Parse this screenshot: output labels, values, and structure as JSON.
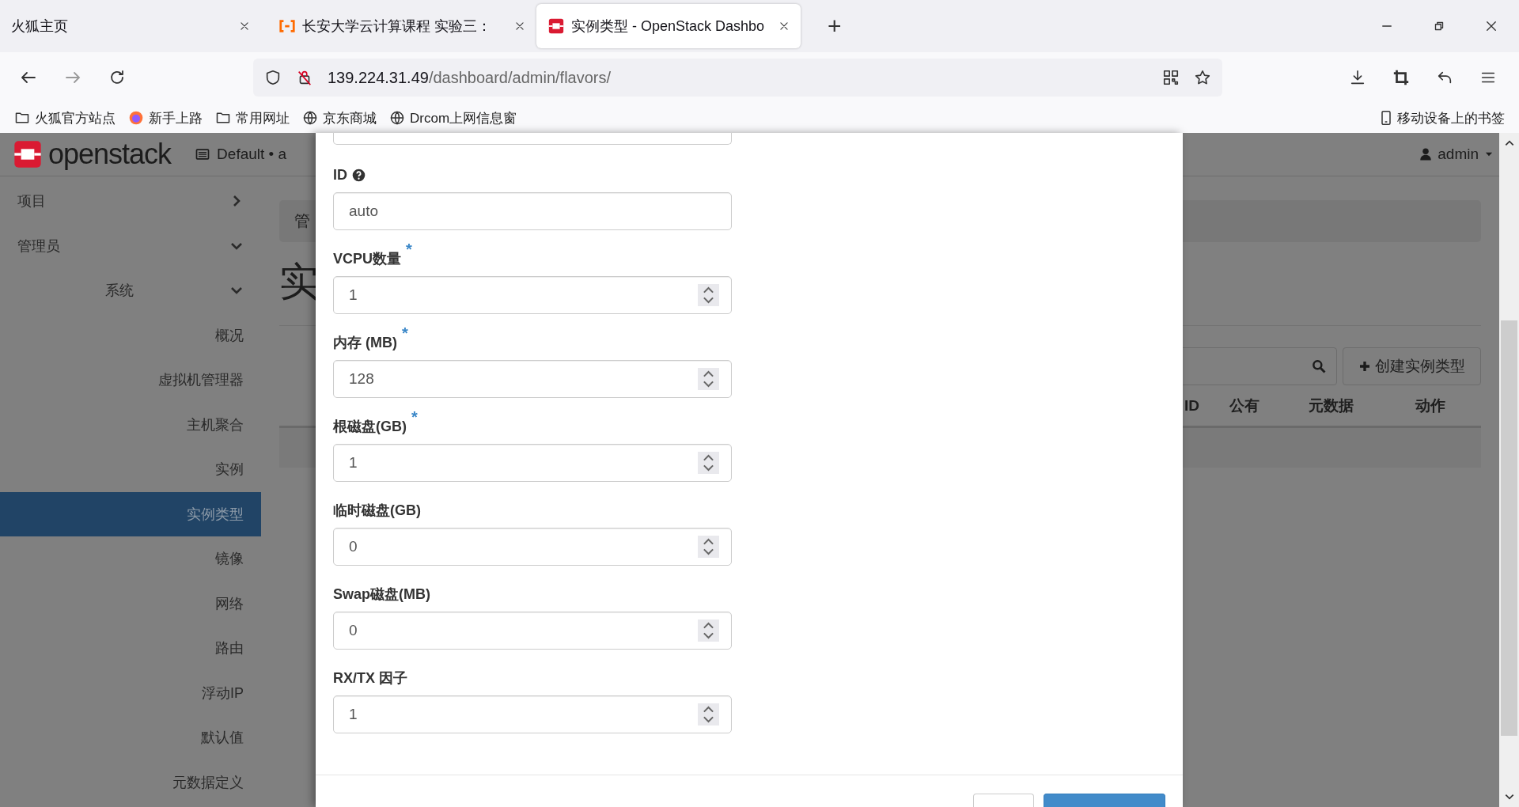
{
  "browser": {
    "tabs": [
      {
        "title": "火狐主页",
        "kind": "plain",
        "selected": false
      },
      {
        "title": "长安大学云计算课程 实验三：",
        "kind": "bracket",
        "selected": false
      },
      {
        "title": "实例类型 - OpenStack Dashbo",
        "kind": "stack",
        "selected": true
      }
    ],
    "new_tab": "+",
    "url": {
      "host": "139.224.31.49",
      "path": "/dashboard/admin/flavors/"
    },
    "bookmarks": [
      {
        "label": "火狐官方站点",
        "kind": "folder"
      },
      {
        "label": "新手上路",
        "kind": "browser"
      },
      {
        "label": "常用网址",
        "kind": "folder"
      },
      {
        "label": "京东商城",
        "kind": "site"
      },
      {
        "label": "Drcom上网信息窗",
        "kind": "site"
      }
    ],
    "mobile_bookmarks": "移动设备上的书签"
  },
  "header": {
    "logo": "openstack",
    "project": "Default • a",
    "user": "admin"
  },
  "sidebar": {
    "items": [
      {
        "label": "项目",
        "expanded": false
      },
      {
        "label": "管理员",
        "expanded": true,
        "children": [
          {
            "label": "系统",
            "expanded": true,
            "children": [
              {
                "label": "概况",
                "selected": false
              },
              {
                "label": "虚拟机管理器",
                "selected": false
              },
              {
                "label": "主机聚合",
                "selected": false
              },
              {
                "label": "实例",
                "selected": false
              },
              {
                "label": "实例类型",
                "selected": true
              },
              {
                "label": "镜像",
                "selected": false
              },
              {
                "label": "网络",
                "selected": false
              },
              {
                "label": "路由",
                "selected": false
              },
              {
                "label": "浮动IP",
                "selected": false
              },
              {
                "label": "默认值",
                "selected": false
              },
              {
                "label": "元数据定义",
                "selected": false
              }
            ]
          }
        ]
      }
    ]
  },
  "main": {
    "breadcrumb": "管",
    "heading": "实",
    "create_button": "创建实例类型",
    "table": {
      "columns": [
        "ID",
        "公有",
        "元数据",
        "动作"
      ]
    }
  },
  "modal": {
    "fields": [
      {
        "kind": "partial"
      },
      {
        "kind": "text",
        "label": "ID",
        "help": true,
        "value": "auto"
      },
      {
        "kind": "number",
        "label": "VCPU数量",
        "required_mark": "*",
        "value": "1"
      },
      {
        "kind": "number",
        "label": "内存 (MB)",
        "required_mark": "*",
        "value": "128"
      },
      {
        "kind": "number",
        "label": "根磁盘(GB)",
        "required_mark": "*",
        "value": "1"
      },
      {
        "kind": "number",
        "label": "临时磁盘(GB)",
        "value": "0"
      },
      {
        "kind": "number",
        "label": "Swap磁盘(MB)",
        "value": "0"
      },
      {
        "kind": "number",
        "label": "RX/TX 因子",
        "value": "1"
      }
    ],
    "footer_buttons": [
      {
        "kind": "default"
      },
      {
        "kind": "primary"
      }
    ]
  }
}
